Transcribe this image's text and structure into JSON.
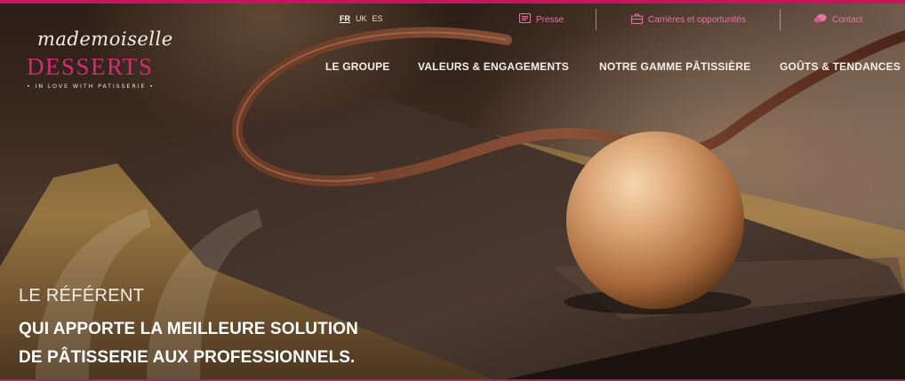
{
  "brand": {
    "script": "mademoiselle",
    "name": "DESSERTS",
    "tagline": "• IN LOVE WITH PATISSERIE •",
    "accent_color": "#d62b73"
  },
  "languages": [
    {
      "label": "FR",
      "active": true
    },
    {
      "label": "UK",
      "active": false
    },
    {
      "label": "ES",
      "active": false
    }
  ],
  "utility": {
    "presse": {
      "label": "Presse",
      "icon": "newspaper-icon"
    },
    "careers": {
      "label": "Carrières et opportunités",
      "icon": "briefcase-icon"
    },
    "contact": {
      "label": "Contact",
      "icon": "chat-bubbles-icon"
    }
  },
  "nav": [
    {
      "label": "LE GROUPE"
    },
    {
      "label": "VALEURS & ENGAGEMENTS"
    },
    {
      "label": "NOTRE GAMME PÂTISSIÈRE"
    },
    {
      "label": "GOÛTS & TENDANCES"
    }
  ],
  "hero": {
    "line1": "LE RÉFÉRENT",
    "line2": "QUI APPORTE LA MEILLEURE SOLUTION",
    "line3": "DE PÂTISSERIE AUX PROFESSIONNELS."
  }
}
